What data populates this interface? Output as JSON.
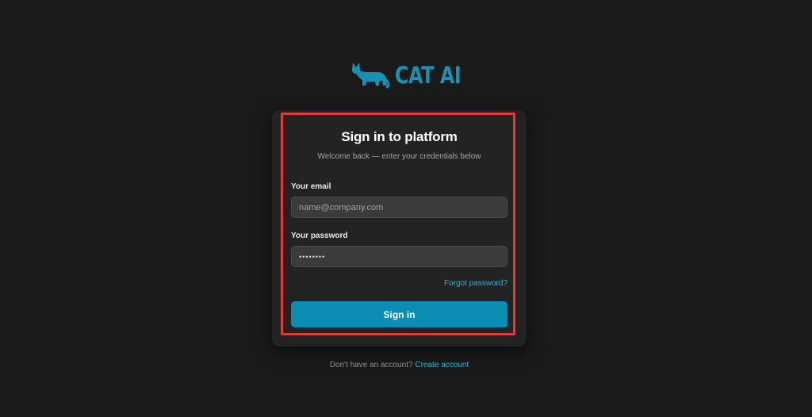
{
  "brand": {
    "name": "CAT AI",
    "color": "#1593b5",
    "icon": "cat-icon"
  },
  "card": {
    "title": "Sign in to platform",
    "subtitle": "Welcome back — enter your credentials below"
  },
  "form": {
    "email_label": "Your email",
    "email_placeholder": "name@company.com",
    "email_value": "",
    "password_label": "Your password",
    "password_value": "••••••••",
    "forgot_link": "Forgot password?",
    "submit_label": "Sign in"
  },
  "footer": {
    "prompt": "Don't have an account?",
    "link": "Create account"
  },
  "colors": {
    "background": "#1a1a1a",
    "card": "#232323",
    "accent": "#0b8eb3",
    "link": "#23b4d8",
    "highlight": "#e53935"
  }
}
